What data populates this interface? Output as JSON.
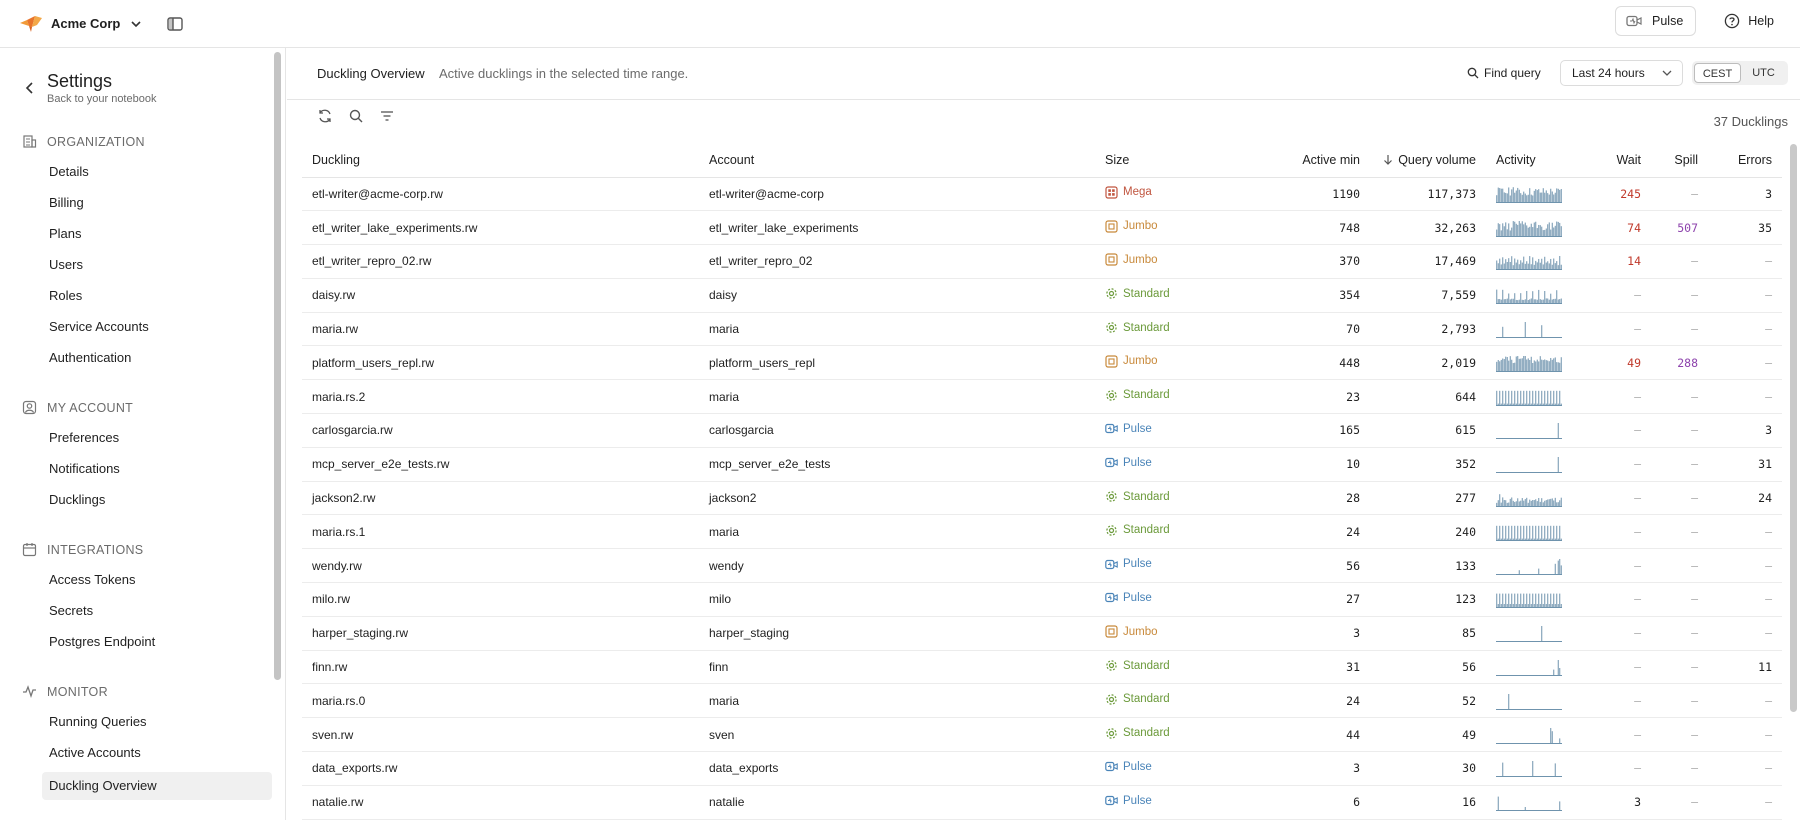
{
  "topbar": {
    "org_name": "Acme Corp",
    "pulse_label": "Pulse",
    "help_label": "Help"
  },
  "sidebar": {
    "title": "Settings",
    "subtitle": "Back to your notebook",
    "sections": [
      {
        "label": "ORGANIZATION",
        "icon": "building-icon",
        "items": [
          "Details",
          "Billing",
          "Plans",
          "Users",
          "Roles",
          "Service Accounts",
          "Authentication"
        ]
      },
      {
        "label": "MY ACCOUNT",
        "icon": "user-square-icon",
        "items": [
          "Preferences",
          "Notifications",
          "Ducklings"
        ]
      },
      {
        "label": "INTEGRATIONS",
        "icon": "calendar-icon",
        "items": [
          "Access Tokens",
          "Secrets",
          "Postgres Endpoint"
        ]
      },
      {
        "label": "MONITOR",
        "icon": "activity-icon",
        "items": [
          "Running Queries",
          "Active Accounts",
          "Duckling Overview"
        ]
      }
    ],
    "active_item": "Duckling Overview"
  },
  "main": {
    "title": "Duckling Overview",
    "description": "Active ducklings in the selected time range.",
    "find_query_label": "Find query",
    "time_range": "Last 24 hours",
    "timezones": [
      "CEST",
      "UTC"
    ],
    "active_timezone": "CEST",
    "count_label": "37 Ducklings"
  },
  "colors": {
    "mega": "#c0553f",
    "jumbo": "#c8893a",
    "standard": "#6b9a3a",
    "pulse": "#4a84b8",
    "spark": "#6f93ad",
    "red": "#c0392b",
    "purple": "#8e44ad"
  },
  "table": {
    "columns": [
      "Duckling",
      "Account",
      "Size",
      "Active min",
      "Query volume",
      "Activity",
      "Wait",
      "Spill",
      "Errors"
    ],
    "sorted_column": "Query volume",
    "sort_direction": "desc",
    "rows": [
      {
        "duckling": "etl-writer@acme-corp.rw",
        "account": "etl-writer@acme-corp",
        "size": "Mega",
        "active_min": "1190",
        "query_volume": "117,373",
        "activity": "dense-1",
        "wait": "245",
        "spill": "—",
        "errors": "3"
      },
      {
        "duckling": "etl_writer_lake_experiments.rw",
        "account": "etl_writer_lake_experiments",
        "size": "Jumbo",
        "active_min": "748",
        "query_volume": "32,263",
        "activity": "dense-2",
        "wait": "74",
        "spill": "507",
        "errors": "35"
      },
      {
        "duckling": "etl_writer_repro_02.rw",
        "account": "etl_writer_repro_02",
        "size": "Jumbo",
        "active_min": "370",
        "query_volume": "17,469",
        "activity": "dense-3",
        "wait": "14",
        "spill": "—",
        "errors": "—"
      },
      {
        "duckling": "daisy.rw",
        "account": "daisy",
        "size": "Standard",
        "active_min": "354",
        "query_volume": "7,559",
        "activity": "mid-1",
        "wait": "—",
        "spill": "—",
        "errors": "—"
      },
      {
        "duckling": "maria.rw",
        "account": "maria",
        "size": "Standard",
        "active_min": "70",
        "query_volume": "2,793",
        "activity": "sparse-1",
        "wait": "—",
        "spill": "—",
        "errors": "—"
      },
      {
        "duckling": "platform_users_repl.rw",
        "account": "platform_users_repl",
        "size": "Jumbo",
        "active_min": "448",
        "query_volume": "2,019",
        "activity": "dense-4",
        "wait": "49",
        "spill": "288",
        "errors": "—"
      },
      {
        "duckling": "maria.rs.2",
        "account": "maria",
        "size": "Standard",
        "active_min": "23",
        "query_volume": "644",
        "activity": "regular-1",
        "wait": "—",
        "spill": "—",
        "errors": "—"
      },
      {
        "duckling": "carlosgarcia.rw",
        "account": "carlosgarcia",
        "size": "Pulse",
        "active_min": "165",
        "query_volume": "615",
        "activity": "spike-end",
        "wait": "—",
        "spill": "—",
        "errors": "3"
      },
      {
        "duckling": "mcp_server_e2e_tests.rw",
        "account": "mcp_server_e2e_tests",
        "size": "Pulse",
        "active_min": "10",
        "query_volume": "352",
        "activity": "spike-end",
        "wait": "—",
        "spill": "—",
        "errors": "31"
      },
      {
        "duckling": "jackson2.rw",
        "account": "jackson2",
        "size": "Standard",
        "active_min": "28",
        "query_volume": "277",
        "activity": "low-dense",
        "wait": "—",
        "spill": "—",
        "errors": "24"
      },
      {
        "duckling": "maria.rs.1",
        "account": "maria",
        "size": "Standard",
        "active_min": "24",
        "query_volume": "240",
        "activity": "regular-1",
        "wait": "—",
        "spill": "—",
        "errors": "—"
      },
      {
        "duckling": "wendy.rw",
        "account": "wendy",
        "size": "Pulse",
        "active_min": "56",
        "query_volume": "133",
        "activity": "ramp-end",
        "wait": "—",
        "spill": "—",
        "errors": "—"
      },
      {
        "duckling": "milo.rw",
        "account": "milo",
        "size": "Pulse",
        "active_min": "27",
        "query_volume": "123",
        "activity": "regular-2",
        "wait": "—",
        "spill": "—",
        "errors": "—"
      },
      {
        "duckling": "harper_staging.rw",
        "account": "harper_staging",
        "size": "Jumbo",
        "active_min": "3",
        "query_volume": "85",
        "activity": "spike-mid",
        "wait": "—",
        "spill": "—",
        "errors": "—"
      },
      {
        "duckling": "finn.rw",
        "account": "finn",
        "size": "Standard",
        "active_min": "31",
        "query_volume": "56",
        "activity": "spike-late",
        "wait": "—",
        "spill": "—",
        "errors": "11"
      },
      {
        "duckling": "maria.rs.0",
        "account": "maria",
        "size": "Standard",
        "active_min": "24",
        "query_volume": "52",
        "activity": "spike-early",
        "wait": "—",
        "spill": "—",
        "errors": "—"
      },
      {
        "duckling": "sven.rw",
        "account": "sven",
        "size": "Standard",
        "active_min": "44",
        "query_volume": "49",
        "activity": "double-late",
        "wait": "—",
        "spill": "—",
        "errors": "—"
      },
      {
        "duckling": "data_exports.rw",
        "account": "data_exports",
        "size": "Pulse",
        "active_min": "3",
        "query_volume": "30",
        "activity": "triple",
        "wait": "—",
        "spill": "—",
        "errors": "—"
      },
      {
        "duckling": "natalie.rw",
        "account": "natalie",
        "size": "Pulse",
        "active_min": "6",
        "query_volume": "16",
        "activity": "sparse-2",
        "wait": "3",
        "spill": "—",
        "errors": "—"
      }
    ]
  }
}
